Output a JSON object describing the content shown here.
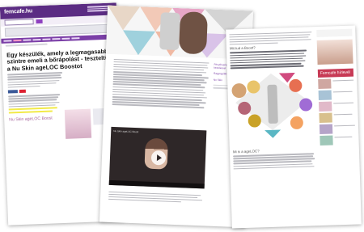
{
  "left_page": {
    "site_logo": "femcafe.hu",
    "article_title": "Egy készülék, amely a legmagasabb szintre emeli a bőrápolást - teszteltük a Nu Skin ageLOC Boostot",
    "share_facebook": "Megosztás",
    "section_label": "Nu Skin ageLOC Boost"
  },
  "middle_page": {
    "video_title": "Nu Skin ageLOC Boost",
    "side_items": [
      "Fényfrissítés ageLOC kezeléssel",
      "Ragyogóbb bőr egyszerűen",
      "Nu Skin"
    ]
  },
  "right_page": {
    "section_header": "Femcafe hírlevél",
    "what_header": "Mi is a ageLOC?",
    "boost_subheading": "Mit tud a Boost?"
  },
  "colors": {
    "brand_purple": "#5b2c83",
    "highlight_yellow": "#f2ea47",
    "accent_red": "#c73a55"
  }
}
